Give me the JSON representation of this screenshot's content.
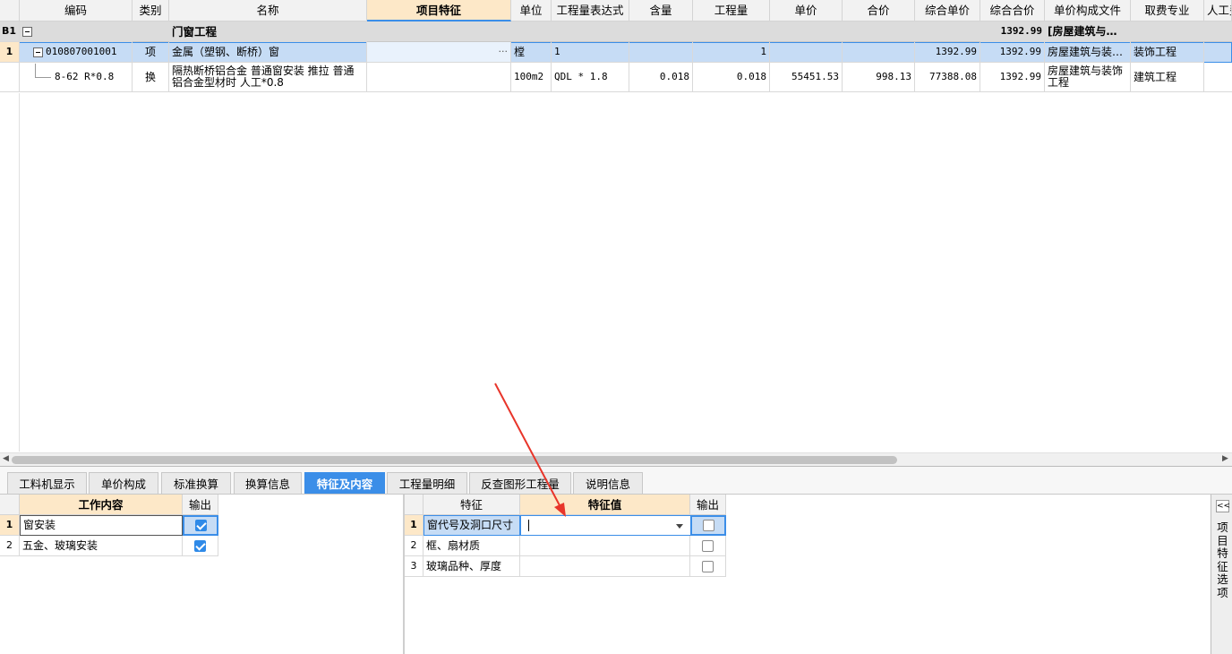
{
  "main_table": {
    "columns": [
      "编码",
      "类别",
      "名称",
      "项目特征",
      "单位",
      "工程量表达式",
      "含量",
      "工程量",
      "单价",
      "合价",
      "综合单价",
      "综合合价",
      "单价构成文件",
      "取费专业",
      "人工费"
    ],
    "section_row": {
      "row_label": "B1",
      "name": "门窗工程",
      "comp_total": "1392.99",
      "unit_file": "[房屋建筑与…"
    },
    "rows": [
      {
        "row_label": "1",
        "code": "010807001001",
        "type": "项",
        "name": "金属（塑钢、断桥）窗",
        "feature": "",
        "feature_button": "···",
        "unit": "樘",
        "expr": "1",
        "content": "",
        "qty": "1",
        "price": "",
        "total": "",
        "comp_price": "1392.99",
        "comp_total": "1392.99",
        "unit_file": "房屋建筑与装…",
        "fee_type": "装饰工程"
      },
      {
        "row_label": "",
        "code": "8-62 R*0.8",
        "type": "换",
        "name_line1": "隔热断桥铝合金 普通窗安装 推拉  普通",
        "name_line2": "铝合金型材时 人工*0.8",
        "feature": "",
        "unit": "100m2",
        "expr": "QDL * 1.8",
        "content": "0.018",
        "qty": "0.018",
        "price": "55451.53",
        "total": "998.13",
        "comp_price": "77388.08",
        "comp_total": "1392.99",
        "unit_file_line1": "房屋建筑与装饰",
        "unit_file_line2": "工程",
        "fee_type": "建筑工程"
      }
    ]
  },
  "tabs": [
    "工料机显示",
    "单价构成",
    "标准换算",
    "换算信息",
    "特征及内容",
    "工程量明细",
    "反查图形工程量",
    "说明信息"
  ],
  "active_tab": "特征及内容",
  "work_content": {
    "headers": [
      "工作内容",
      "输出"
    ],
    "rows": [
      {
        "num": "1",
        "text": "窗安装",
        "checked": true
      },
      {
        "num": "2",
        "text": "五金、玻璃安装",
        "checked": true
      }
    ]
  },
  "features": {
    "headers": [
      "特征",
      "特征值",
      "输出"
    ],
    "rows": [
      {
        "num": "1",
        "name": "窗代号及洞口尺寸",
        "value": "",
        "checked": false
      },
      {
        "num": "2",
        "name": "框、扇材质",
        "value": "",
        "checked": false
      },
      {
        "num": "3",
        "name": "玻璃品种、厚度",
        "value": "",
        "checked": false
      }
    ]
  },
  "side_panel": {
    "collapse_glyph": "<<",
    "label_chars": [
      "项",
      "目",
      "特",
      "征",
      "选",
      "项"
    ]
  },
  "scroll": {
    "left_arrow": "◀",
    "right_arrow": "▶"
  },
  "colors": {
    "accent": "#3b8ee8",
    "header_highlight": "#fde8c8",
    "selected_row": "#c6dcf5",
    "annotation_arrow": "#e8352a"
  }
}
